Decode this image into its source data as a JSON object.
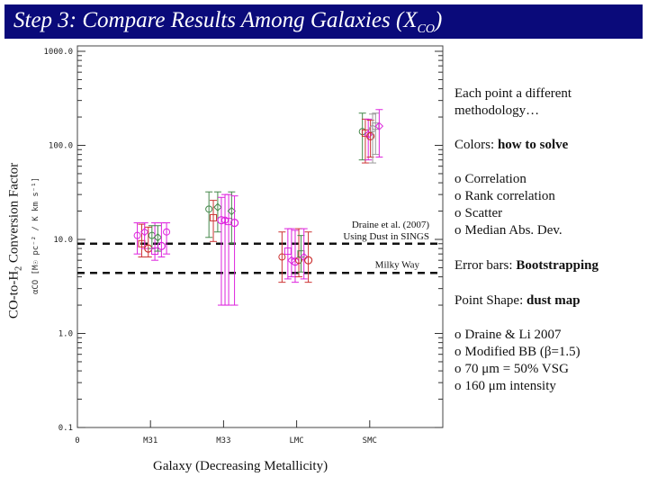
{
  "header": {
    "title_main": "Step 3: Compare Results Among Galaxies (X",
    "title_sub": "CO",
    "title_end": ")"
  },
  "side_notes": {
    "intro": "Each point a different methodology…",
    "colors_label": "Colors: ",
    "colors_value": "how to solve",
    "color_methods": [
      {
        "bullet": "o",
        "label": "Correlation"
      },
      {
        "bullet": "o",
        "label": "Rank correlation"
      },
      {
        "bullet": "o",
        "label": "Scatter"
      },
      {
        "bullet": "o",
        "label": "Median Abs. Dev."
      }
    ],
    "errorbars_label": "Error bars: ",
    "errorbars_value": "Bootstrapping",
    "shape_label": "Point Shape: ",
    "shape_value": "dust map",
    "shape_maps": [
      {
        "bullet": "o",
        "label": "Draine & Li 2007"
      },
      {
        "bullet": "o",
        "label": "Modified BB (β=1.5)"
      },
      {
        "bullet": "o",
        "label": "70 μm = 50% VSG"
      },
      {
        "bullet": "o",
        "label": "160 μm intensity"
      }
    ]
  },
  "chart_data": {
    "type": "scatter",
    "title": "",
    "xlabel": "Galaxy (Decreasing Metallicity)",
    "ylabel": "CO-to-H2 Conversion Factor",
    "ylabel_units": "αCO [M☉ pc⁻² / K km s⁻¹]",
    "yscale": "log",
    "ylim": [
      0.1,
      1000
    ],
    "xlim": [
      0,
      5
    ],
    "yticks": [
      0.1,
      1.0,
      10.0,
      100.0,
      1000.0
    ],
    "ytick_labels": [
      "0.1",
      "1.0",
      "10.0",
      "100.0",
      "1000.0"
    ],
    "xticks": [
      0,
      1,
      2,
      3,
      4
    ],
    "xtick_labels": [
      "0",
      "M31",
      "M33",
      "LMC",
      "SMC"
    ],
    "grid": false,
    "reference_lines": [
      {
        "label": "Draine et al. (2007) Using Dust in SINGS",
        "label_line1": "Draine et al. (2007)",
        "label_line2": "Using Dust in SINGS",
        "value": 9.0,
        "style": "dashed"
      },
      {
        "label": "Milky Way",
        "value": 4.4,
        "style": "dashed"
      }
    ],
    "colors": {
      "correlation": "#cc3333",
      "rank_correlation": "#44884a",
      "scatter": "#dd22dd",
      "median_abs_dev": "#aaaaaa"
    },
    "series": [
      {
        "name": "M31",
        "x_center": 1,
        "points": [
          {
            "dx": -0.18,
            "y": 11.0,
            "lo": 7.0,
            "hi": 15.0,
            "color": "magenta"
          },
          {
            "dx": -0.12,
            "y": 9.0,
            "lo": 6.5,
            "hi": 14.5,
            "color": "red"
          },
          {
            "dx": -0.08,
            "y": 12.0,
            "lo": 8.0,
            "hi": 15.0,
            "color": "magenta"
          },
          {
            "dx": -0.03,
            "y": 8.0,
            "lo": 6.5,
            "hi": 13.5,
            "color": "red"
          },
          {
            "dx": 0.02,
            "y": 11.0,
            "lo": 8.0,
            "hi": 14.0,
            "color": "green"
          },
          {
            "dx": 0.06,
            "y": 7.5,
            "lo": 6.0,
            "hi": 15.0,
            "color": "magenta"
          },
          {
            "dx": 0.1,
            "y": 10.5,
            "lo": 7.5,
            "hi": 14.0,
            "color": "green"
          },
          {
            "dx": 0.15,
            "y": 8.5,
            "lo": 6.5,
            "hi": 15.0,
            "color": "magenta"
          },
          {
            "dx": 0.22,
            "y": 12.0,
            "lo": 7.0,
            "hi": 15.0,
            "color": "magenta"
          }
        ]
      },
      {
        "name": "M33",
        "x_center": 2,
        "points": [
          {
            "dx": -0.2,
            "y": 21.0,
            "lo": 10.5,
            "hi": 32.0,
            "color": "green"
          },
          {
            "dx": -0.14,
            "y": 17.0,
            "lo": 9.5,
            "hi": 26.0,
            "color": "red"
          },
          {
            "dx": -0.08,
            "y": 22.0,
            "lo": 12.0,
            "hi": 32.0,
            "color": "green"
          },
          {
            "dx": -0.03,
            "y": 16.0,
            "lo": 2.0,
            "hi": 28.0,
            "color": "magenta"
          },
          {
            "dx": 0.02,
            "y": 16.0,
            "lo": 2.0,
            "hi": 30.0,
            "color": "magenta"
          },
          {
            "dx": 0.07,
            "y": 15.5,
            "lo": 2.0,
            "hi": 30.0,
            "color": "magenta"
          },
          {
            "dx": 0.11,
            "y": 20.0,
            "lo": 9.0,
            "hi": 32.0,
            "color": "green"
          },
          {
            "dx": 0.15,
            "y": 15.0,
            "lo": 2.0,
            "hi": 29.0,
            "color": "magenta"
          }
        ]
      },
      {
        "name": "LMC",
        "x_center": 3,
        "points": [
          {
            "dx": -0.2,
            "y": 6.5,
            "lo": 3.5,
            "hi": 12.0,
            "color": "red"
          },
          {
            "dx": -0.12,
            "y": 7.5,
            "lo": 3.8,
            "hi": 13.0,
            "color": "magenta"
          },
          {
            "dx": -0.07,
            "y": 6.0,
            "lo": 4.0,
            "hi": 13.0,
            "color": "magenta"
          },
          {
            "dx": -0.02,
            "y": 5.8,
            "lo": 3.5,
            "hi": 12.5,
            "color": "magenta"
          },
          {
            "dx": 0.03,
            "y": 6.0,
            "lo": 4.0,
            "hi": 13.0,
            "color": "red"
          },
          {
            "dx": 0.06,
            "y": 7.0,
            "lo": 4.5,
            "hi": 11.0,
            "color": "green"
          },
          {
            "dx": 0.1,
            "y": 6.5,
            "lo": 3.8,
            "hi": 13.0,
            "color": "magenta"
          },
          {
            "dx": 0.16,
            "y": 6.0,
            "lo": 3.5,
            "hi": 12.0,
            "color": "red"
          }
        ]
      },
      {
        "name": "SMC",
        "x_center": 4,
        "points": [
          {
            "dx": -0.1,
            "y": 140.0,
            "lo": 70.0,
            "hi": 220.0,
            "color": "green"
          },
          {
            "dx": -0.06,
            "y": 135.0,
            "lo": 65.0,
            "hi": 190.0,
            "color": "red"
          },
          {
            "dx": -0.02,
            "y": 130.0,
            "lo": 70.0,
            "hi": 190.0,
            "color": "magenta"
          },
          {
            "dx": 0.01,
            "y": 125.0,
            "lo": 75.0,
            "hi": 185.0,
            "color": "red"
          },
          {
            "dx": 0.04,
            "y": 150.0,
            "lo": 65.0,
            "hi": 215.0,
            "color": "gray"
          },
          {
            "dx": 0.08,
            "y": 160.0,
            "lo": 80.0,
            "hi": 220.0,
            "color": "gray"
          },
          {
            "dx": 0.13,
            "y": 160.0,
            "lo": 75.0,
            "hi": 240.0,
            "color": "magenta"
          }
        ]
      }
    ]
  }
}
